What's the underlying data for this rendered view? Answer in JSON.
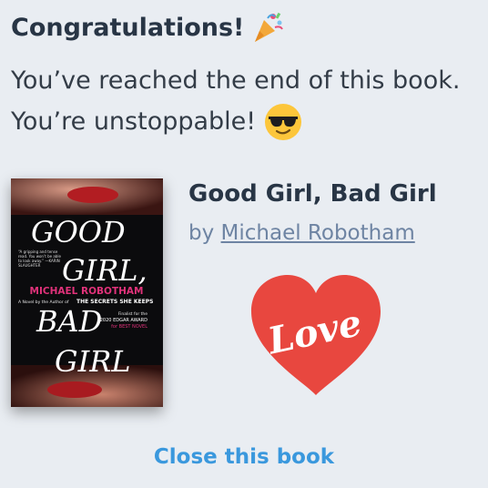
{
  "header": {
    "title": "Congratulations!",
    "title_icon": "party-popper-icon"
  },
  "message": {
    "line1": "You’ve reached the end of this book.",
    "line2": "You’re unstoppable!",
    "line2_icon": "sunglasses-face-icon"
  },
  "book": {
    "title": "Good Girl, Bad Girl",
    "by_prefix": "by",
    "author": "Michael Robotham",
    "cover": {
      "title_word1": "GOOD",
      "title_word2": "GIRL,",
      "title_word3": "BAD",
      "title_word4": "GIRL",
      "author": "MICHAEL ROBOTHAM",
      "blurb": "“A gripping and tense read. You won’t be able to look away.” —KARIN SLAUGHTER",
      "tagline_prefix": "A Novel by the Author of",
      "tagline_title": "THE SECRETS SHE KEEPS",
      "award_line1": "Finalist for the",
      "award_line2": "2020 EDGAR AWARD",
      "award_line3": "for BEST NOVEL"
    }
  },
  "love_badge": {
    "text": "Love",
    "color": "#e8473f"
  },
  "actions": {
    "close_label": "Close this book"
  },
  "colors": {
    "background": "#e9edf2",
    "heading": "#283545",
    "link": "#3a98dd",
    "author_link": "#6e84a3"
  }
}
